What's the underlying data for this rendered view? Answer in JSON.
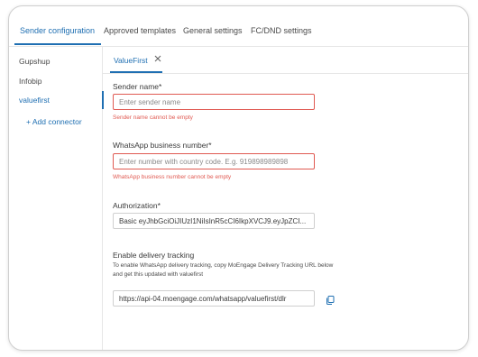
{
  "nav": {
    "tabs": [
      {
        "label": "Sender configuration"
      },
      {
        "label": "Approved templates"
      },
      {
        "label": "General settings"
      },
      {
        "label": "FC/DND settings"
      }
    ]
  },
  "sidebar": {
    "items": [
      {
        "label": "Gupshup"
      },
      {
        "label": "Infobip"
      },
      {
        "label": "valuefirst"
      }
    ],
    "add_label": "+ Add connector"
  },
  "subtab": {
    "label": "ValueFirst"
  },
  "form": {
    "sender_name": {
      "label": "Sender name*",
      "placeholder": "Enter sender name",
      "error": "Sender name cannot be empty"
    },
    "whatsapp_number": {
      "label": "WhatsApp business number*",
      "placeholder": "Enter number with country code. E.g. 919898989898",
      "error": "WhatsApp business number cannot be empty"
    },
    "authorization": {
      "label": "Authorization*",
      "value": "Basic eyJhbGciOiJIUzI1NiIsInR5cCI6IkpXVCJ9.eyJpZCI..."
    },
    "delivery_tracking": {
      "label": "Enable delivery tracking",
      "hint_line1": "To enable WhatsApp delivery tracking, copy MoEngage Delivery Tracking URL below",
      "hint_line2": "and get this updated with valuefirst",
      "url": "https://api-04.moengage.com/whatsapp/valuefirst/dlr"
    }
  },
  "colors": {
    "accent": "#1f6fb2",
    "error": "#e05a52",
    "border": "#cfcfcf"
  },
  "icons": [
    "close-icon",
    "copy-icon"
  ]
}
